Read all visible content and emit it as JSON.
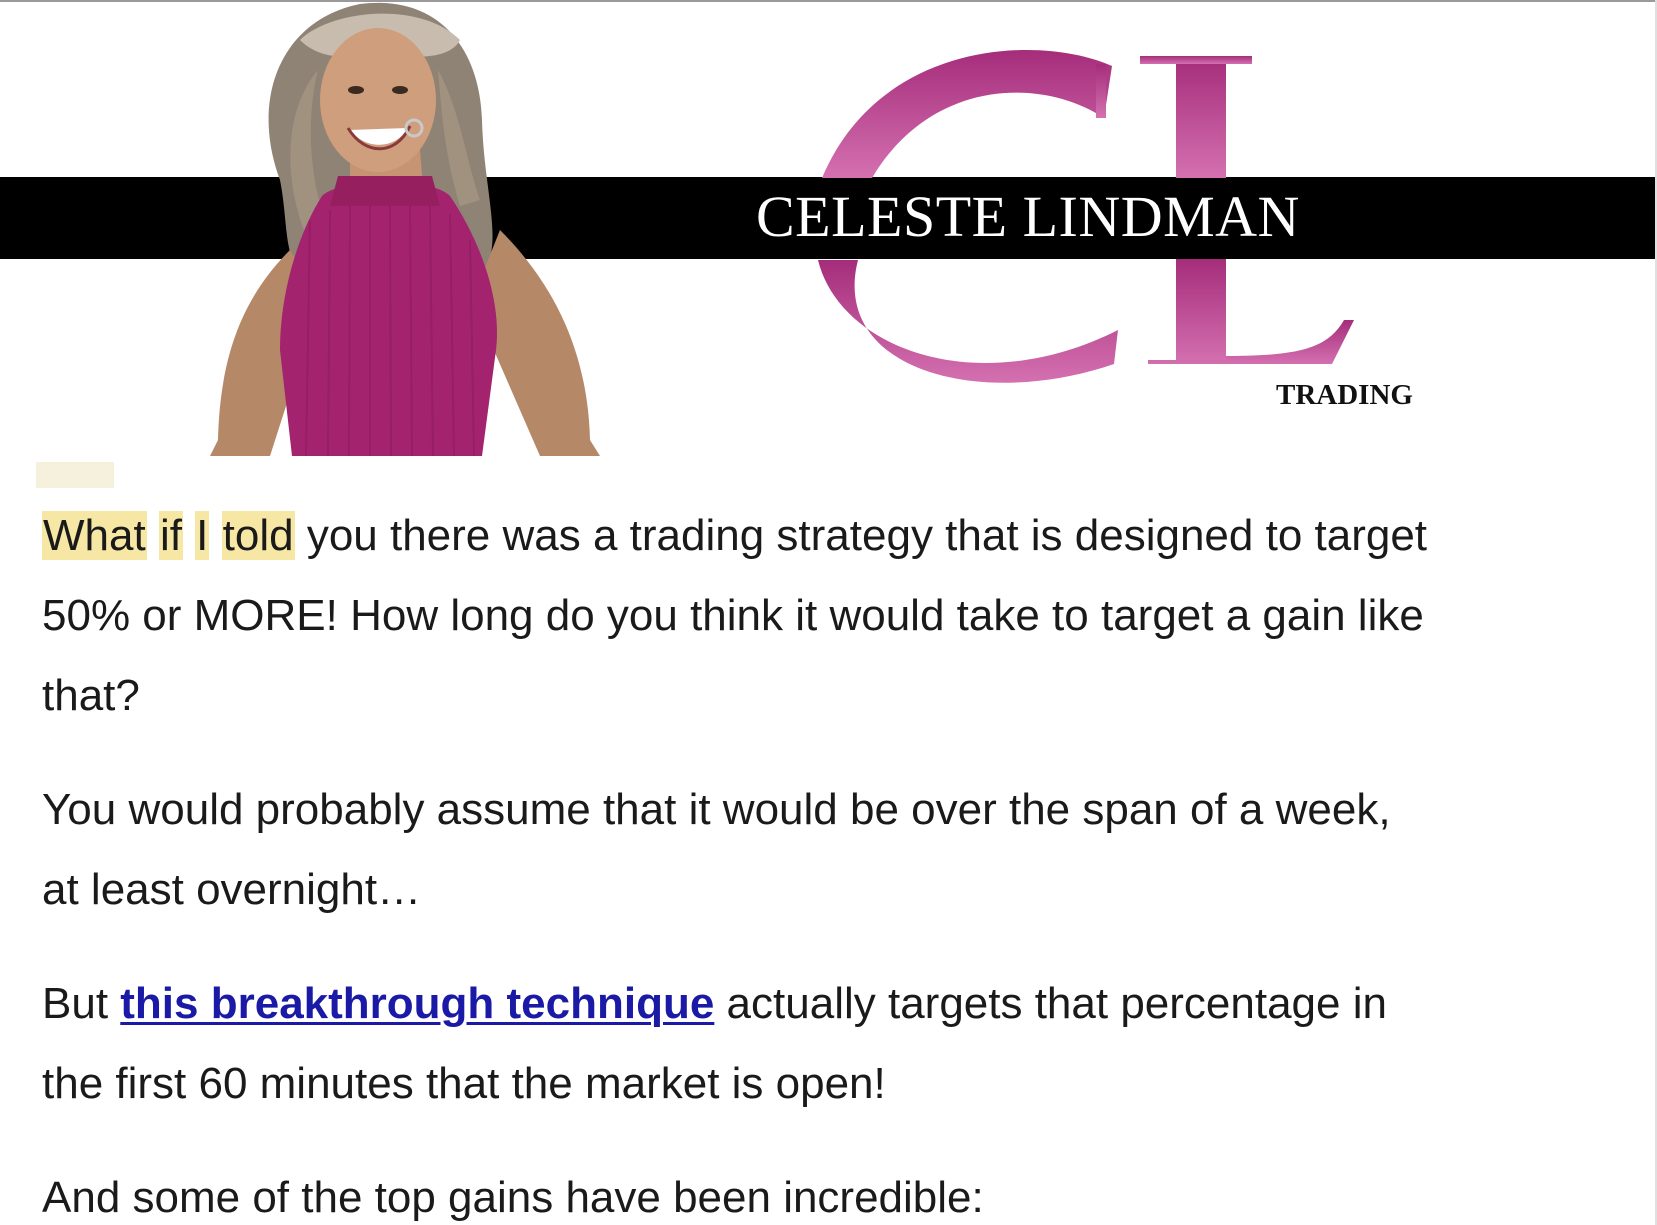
{
  "header": {
    "brand_name": "CELESTE LINDMAN",
    "brand_sub": "TRADING",
    "monogram": "CL"
  },
  "body": {
    "p1": {
      "w1": "What",
      "w2": "if",
      "w3": "I",
      "w4": "told",
      "line1_rest": " you there was a trading strategy that is designed to target",
      "line2": "50% or MORE! How long do you think it would take to target a gain like",
      "line3": "that?"
    },
    "p2": {
      "line1": "You would probably assume that it would be over the span of a week,",
      "line2": "at least overnight…"
    },
    "p3": {
      "prefix": "But ",
      "link_text": "this breakthrough technique",
      "suffix": " actually targets that percentage in",
      "line2": "the first 60 minutes that the market is open!"
    },
    "p4": {
      "line1": "And some of the top gains have been incredible:"
    }
  },
  "colors": {
    "monogram": "#c0428f",
    "band": "#000000",
    "highlight": "#f7e7a4",
    "link": "#1a1aa6",
    "top_color": "#a3236f"
  }
}
